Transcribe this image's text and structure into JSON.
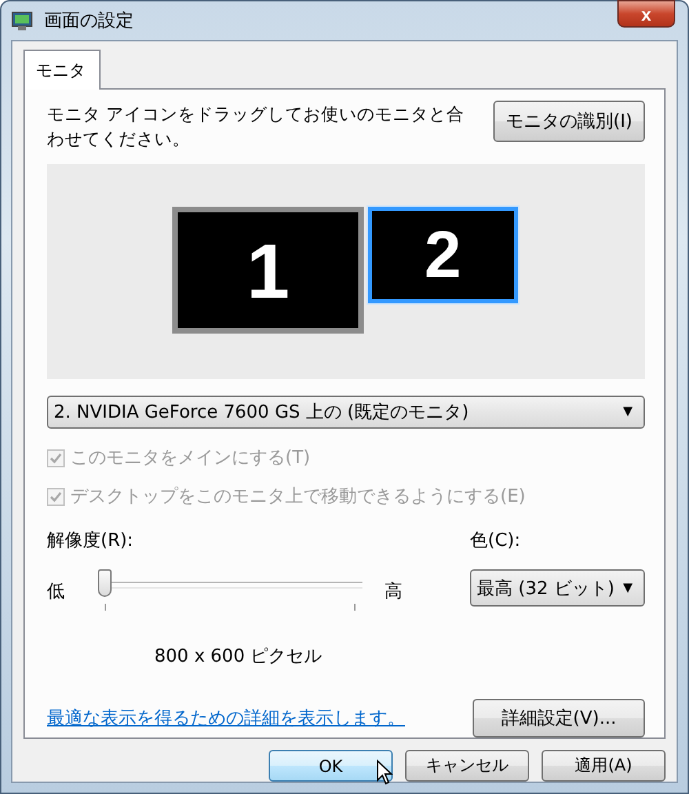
{
  "window": {
    "title": "画面の設定",
    "close": "x"
  },
  "tabs": [
    {
      "label": "モニタ",
      "selected": true
    }
  ],
  "instructions": "モニタ アイコンをドラッグしてお使いのモニタと合わせてください。",
  "identify_button": "モニタの識別(I)",
  "monitors": [
    {
      "label": "1",
      "selected": false
    },
    {
      "label": "2",
      "selected": true
    }
  ],
  "display_dropdown": {
    "value": "2. NVIDIA GeForce 7600 GS  上の (既定のモニタ)",
    "caret": "▼"
  },
  "checkboxes": [
    {
      "label": "このモニタをメインにする(T)",
      "checked": true,
      "disabled": true
    },
    {
      "label": "デスクトップをこのモニタ上で移動できるようにする(E)",
      "checked": true,
      "disabled": true
    }
  ],
  "resolution": {
    "label": "解像度(R):",
    "low": "低",
    "high": "高",
    "level": 0,
    "reading": "800 x 600 ピクセル"
  },
  "color": {
    "label": "色(C):",
    "value": "最高 (32 ビット)",
    "caret": "▼"
  },
  "help_link": "最適な表示を得るための詳細を表示します。",
  "advanced_button": "詳細設定(V)...",
  "buttons": [
    {
      "label": "OK",
      "default": true
    },
    {
      "label": "キャンセル",
      "default": false
    },
    {
      "label": "適用(A)",
      "default": false
    }
  ]
}
